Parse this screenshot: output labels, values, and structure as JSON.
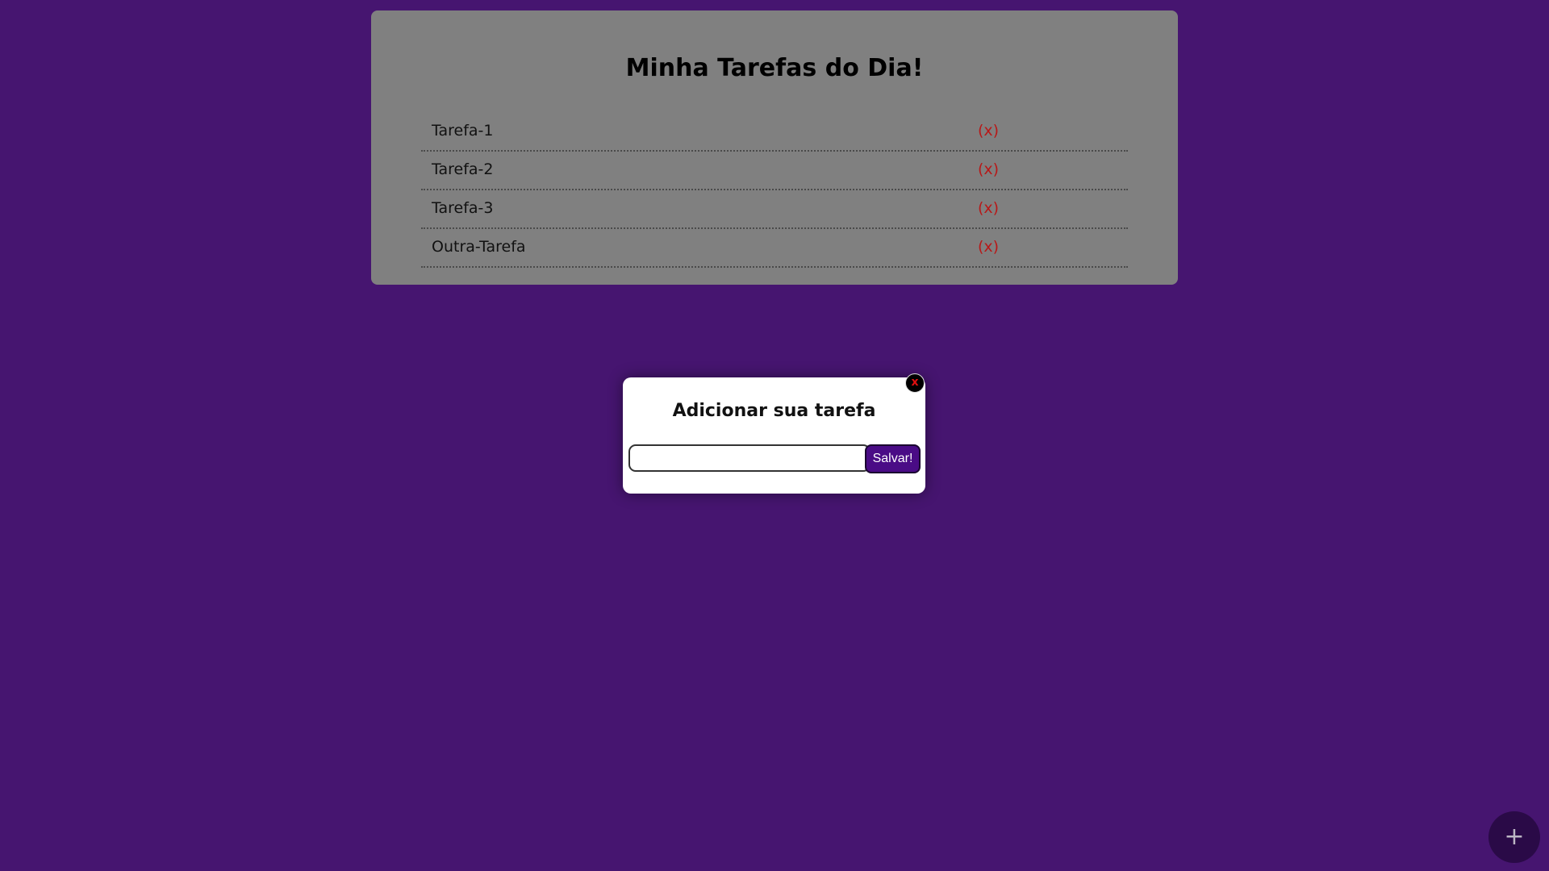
{
  "list": {
    "title": "Minha Tarefas do Dia!",
    "remove_label": "(x)",
    "items": [
      {
        "label": "Tarefa-1"
      },
      {
        "label": "Tarefa-2"
      },
      {
        "label": "Tarefa-3"
      },
      {
        "label": "Outra-Tarefa"
      }
    ]
  },
  "modal": {
    "title": "Adicionar sua tarefa",
    "close_label": "x",
    "input_value": "",
    "input_placeholder": "",
    "save_label": "Salvar!"
  },
  "fab": {
    "label": "+"
  },
  "colors": {
    "background": "#461570",
    "card": "#808080",
    "remove": "#b81818",
    "button": "#4a0c86"
  }
}
